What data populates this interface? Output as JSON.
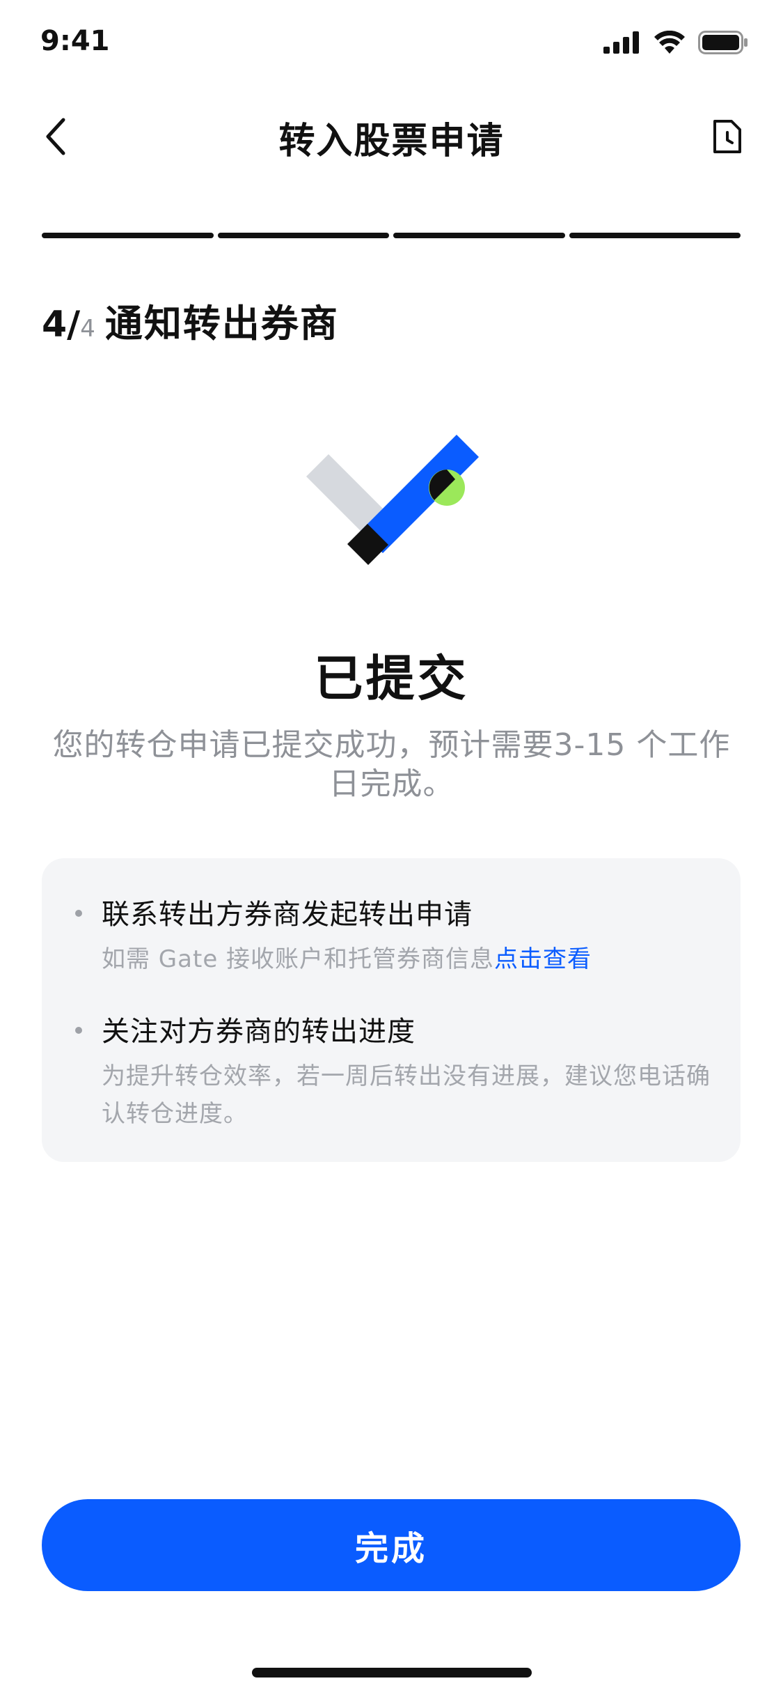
{
  "status_bar": {
    "time": "9:41",
    "icons": [
      "signal-icon",
      "wifi-icon",
      "battery-icon"
    ]
  },
  "nav": {
    "title": "转入股票申请",
    "back_icon": "chevron-left-icon",
    "history_icon": "document-clock-icon"
  },
  "progress": {
    "total_steps": 4,
    "completed_steps": 4
  },
  "step": {
    "current": "4/",
    "total": "4",
    "title": "通知转出券商"
  },
  "result": {
    "title": "已提交",
    "description": "您的转仓申请已提交成功，预计需要3-15 个工作日完成。"
  },
  "info": {
    "items": [
      {
        "title": "联系转出方券商发起转出申请",
        "sub_text": "如需 Gate 接收账户和托管券商信息",
        "link_text": "点击查看"
      },
      {
        "title": "关注对方券商的转出进度",
        "sub_text": "为提升转仓效率，若一周后转出没有进展，建议您电话确认转仓进度。"
      }
    ]
  },
  "footer": {
    "done_label": "完成"
  },
  "colors": {
    "accent": "#0A5CFF",
    "text": "#111111",
    "secondary_text": "#8E9197",
    "panel": "#F4F5F7",
    "highlight_green": "#9BE85A"
  }
}
